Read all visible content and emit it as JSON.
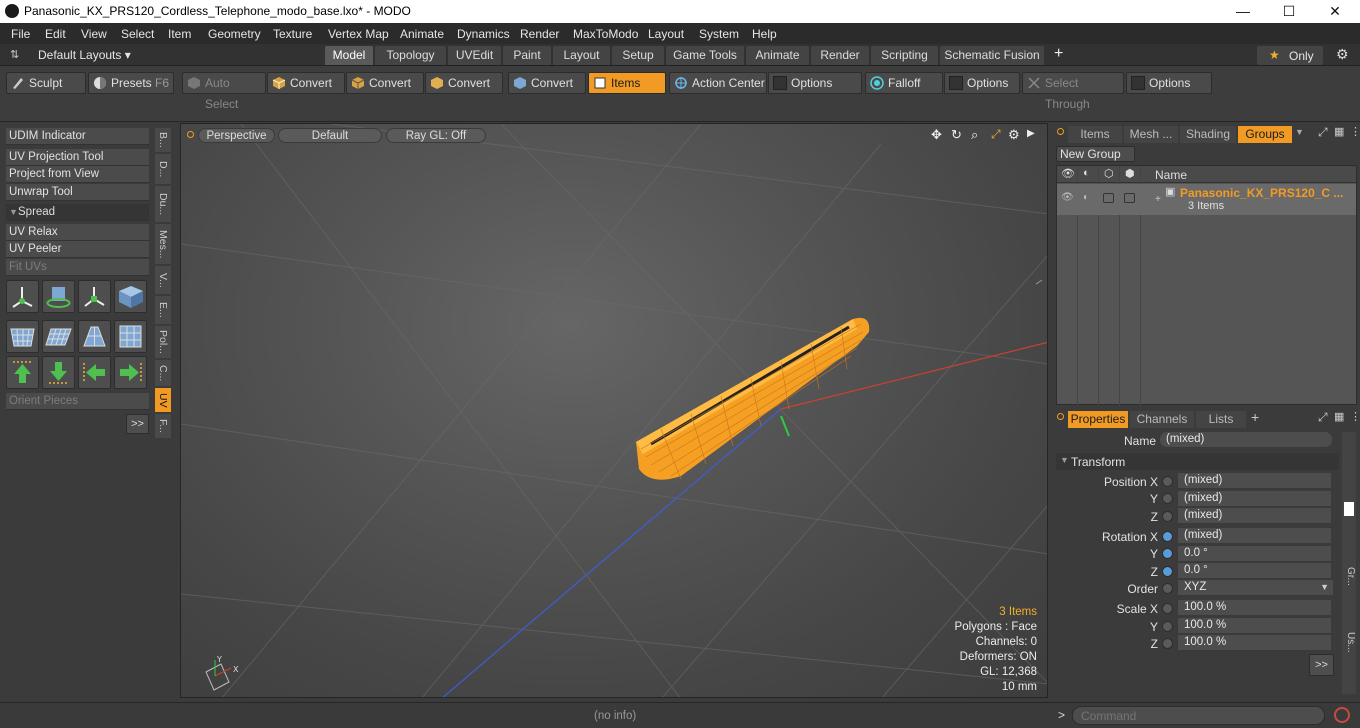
{
  "window": {
    "title": "Panasonic_KX_PRS120_Cordless_Telephone_modo_base.lxo* - MODO",
    "minimize": "—",
    "maximize": "☐",
    "close": "✕"
  },
  "menu": [
    "File",
    "Edit",
    "View",
    "Select",
    "Item",
    "Geometry",
    "Texture",
    "Vertex Map",
    "Animate",
    "Dynamics",
    "Render",
    "MaxToModo",
    "Layout",
    "System",
    "Help"
  ],
  "layouts": {
    "label": "Default Layouts ▾",
    "tabs": [
      "Model",
      "Topology",
      "UVEdit",
      "Paint",
      "Layout",
      "Setup",
      "Game Tools",
      "Animate",
      "Render",
      "Scripting",
      "Schematic Fusion"
    ],
    "active_tab": "Model",
    "add": "+",
    "only_label": "Only"
  },
  "toolbar": {
    "sculpt": "Sculpt",
    "presets": "Presets",
    "presets_key": "F6",
    "auto_select": "Auto Select",
    "convert1": "Convert",
    "convert2": "Convert",
    "convert3": "Convert",
    "convert4": "Convert",
    "items": "Items",
    "action_center": "Action Center",
    "options1": "Options",
    "falloff": "Falloff",
    "options2": "Options",
    "select_through": "Select Through",
    "options3": "Options"
  },
  "left_panel": {
    "udim": "UDIM Indicator",
    "uv_projection": "UV Projection Tool",
    "project_from_view": "Project from View",
    "unwrap": "Unwrap Tool",
    "spread": "Spread",
    "uv_relax": "UV Relax",
    "uv_peeler": "UV Peeler",
    "fit_uvs": "Fit UVs",
    "orient_pieces": "Orient Pieces",
    "more": ">>",
    "vtabs": [
      "B...",
      "D...",
      "Du...",
      "Mes...",
      "V...",
      "E...",
      "Pol...",
      "C...",
      "UV",
      "F..."
    ]
  },
  "viewport": {
    "perspective": "Perspective",
    "default": "Default",
    "raygl": "Ray GL: Off",
    "hud": {
      "items": "3 Items",
      "polygons": "Polygons : Face",
      "channels": "Channels: 0",
      "deformers": "Deformers: ON",
      "gl": "GL: 12,368",
      "scale": "10 mm"
    }
  },
  "groups_panel": {
    "tabs": [
      "Items",
      "Mesh ...",
      "Shading",
      "Groups"
    ],
    "active_tab": "Groups",
    "new_group": "New Group",
    "col_name": "Name",
    "group_name": "Panasonic_KX_PRS120_C ...",
    "group_count": "3 Items"
  },
  "properties_panel": {
    "tabs": [
      "Properties",
      "Channels",
      "Lists"
    ],
    "add": "+",
    "name_label": "Name",
    "name_value": "(mixed)",
    "transform": "Transform",
    "position_x_label": "Position X",
    "position_x": "(mixed)",
    "position_y": "(mixed)",
    "position_z": "(mixed)",
    "rotation_x_label": "Rotation X",
    "rotation_x": "(mixed)",
    "rotation_y": "0.0 °",
    "rotation_z": "0.0 °",
    "order_label": "Order",
    "order": "XYZ",
    "scale_x_label": "Scale X",
    "scale_x": "100.0 %",
    "scale_y": "100.0 %",
    "scale_z": "100.0 %",
    "y": "Y",
    "z": "Z",
    "more": ">>",
    "side_tabs": [
      "Gr...",
      "Us..."
    ]
  },
  "status": {
    "info": "(no info)",
    "prompt": ">",
    "command_placeholder": "Command"
  },
  "colors": {
    "accent": "#f29b24",
    "background": "#3b3b3b",
    "mesh": "#f5a023"
  }
}
